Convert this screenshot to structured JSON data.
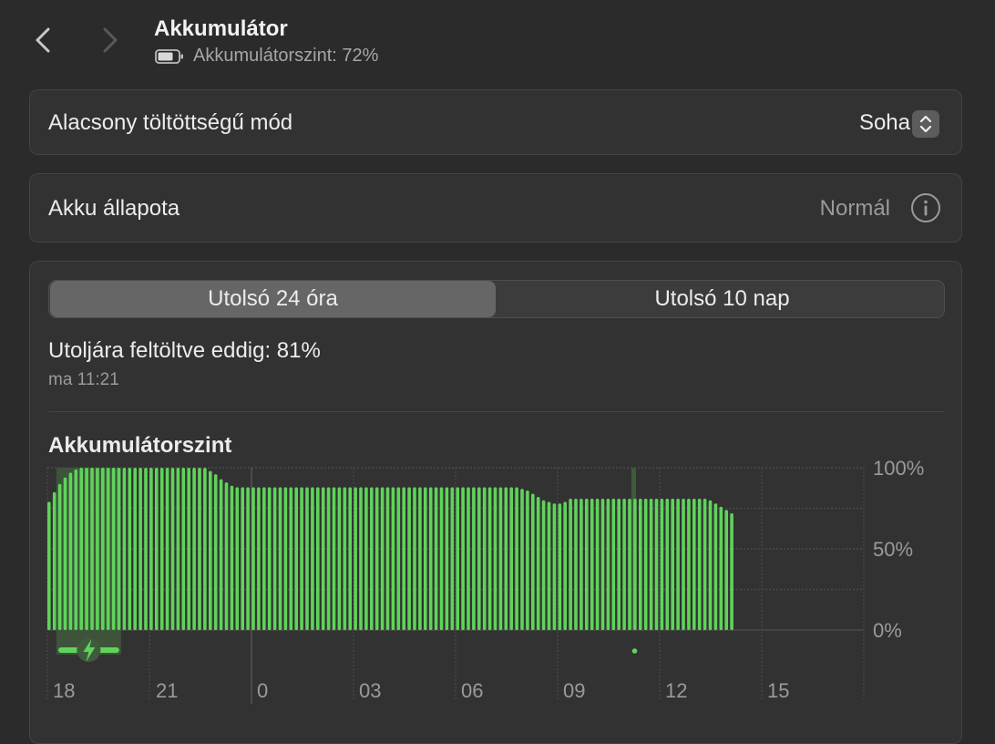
{
  "header": {
    "title": "Akkumulátor",
    "subtitle": "Akkumulátorszint: 72%"
  },
  "low_power": {
    "label": "Alacsony töltöttségű mód",
    "value": "Soha"
  },
  "health": {
    "label": "Akku állapota",
    "value": "Normál"
  },
  "tabs": [
    {
      "label": "Utolsó 24 óra",
      "selected": true
    },
    {
      "label": "Utolsó 10 nap",
      "selected": false
    }
  ],
  "last_charge": {
    "text": "Utoljára feltöltve eddig: 81%",
    "time": "ma 11:21"
  },
  "colors": {
    "bar": "#5fd35a",
    "charging_bg": "#3f5b3c"
  },
  "chart_data": {
    "type": "bar",
    "title": "Akkumulátorszint",
    "y_ticks": [
      "100%",
      "50%",
      "0%"
    ],
    "ylim": [
      0,
      100
    ],
    "x_ticks": [
      "18",
      "21",
      "0",
      "03",
      "06",
      "09",
      "12",
      "15"
    ],
    "values": [
      79,
      85,
      90,
      94,
      97,
      99,
      100,
      100,
      100,
      100,
      100,
      100,
      100,
      100,
      100,
      100,
      100,
      100,
      100,
      100,
      100,
      100,
      100,
      100,
      100,
      100,
      100,
      100,
      100,
      100,
      98,
      96,
      93,
      91,
      89,
      88,
      88,
      88,
      88,
      88,
      88,
      88,
      88,
      88,
      88,
      88,
      88,
      88,
      88,
      88,
      88,
      88,
      88,
      88,
      88,
      88,
      88,
      88,
      88,
      88,
      88,
      88,
      88,
      88,
      88,
      88,
      88,
      88,
      88,
      88,
      88,
      88,
      88,
      88,
      88,
      88,
      88,
      88,
      88,
      88,
      88,
      88,
      88,
      88,
      88,
      88,
      88,
      88,
      87,
      86,
      84,
      82,
      80,
      79,
      78,
      78,
      79,
      81,
      81,
      81,
      81,
      81,
      81,
      81,
      81,
      81,
      81,
      81,
      81,
      81,
      81,
      81,
      81,
      81,
      81,
      81,
      81,
      81,
      81,
      81,
      81,
      81,
      81,
      80,
      78,
      76,
      74,
      72
    ],
    "charging": [
      {
        "from_index": 1,
        "to_index": 12,
        "label": "charging"
      }
    ]
  }
}
